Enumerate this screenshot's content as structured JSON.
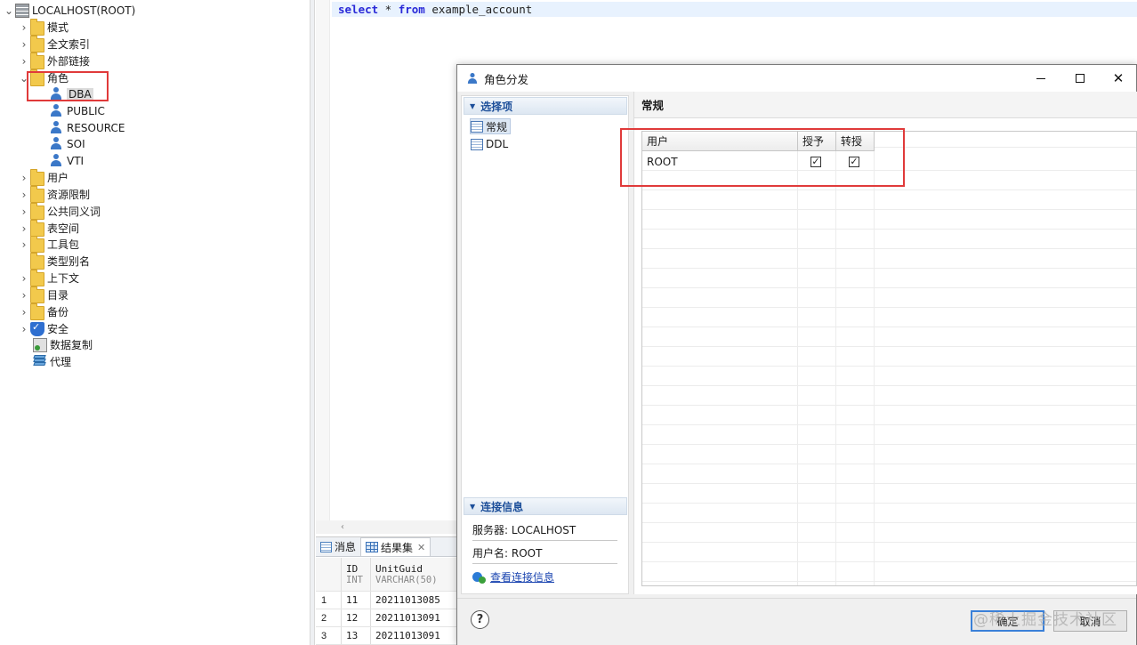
{
  "tree": {
    "root_label": "LOCALHOST(ROOT)",
    "items": [
      {
        "label": "模式"
      },
      {
        "label": "全文索引"
      },
      {
        "label": "外部链接"
      },
      {
        "label": "角色"
      },
      {
        "label": "DBA"
      },
      {
        "label": "PUBLIC"
      },
      {
        "label": "RESOURCE"
      },
      {
        "label": "SOI"
      },
      {
        "label": "VTI"
      },
      {
        "label": "用户"
      },
      {
        "label": "资源限制"
      },
      {
        "label": "公共同义词"
      },
      {
        "label": "表空间"
      },
      {
        "label": "工具包"
      },
      {
        "label": "类型别名"
      },
      {
        "label": "上下文"
      },
      {
        "label": "目录"
      },
      {
        "label": "备份"
      },
      {
        "label": "安全"
      },
      {
        "label": "数据复制"
      },
      {
        "label": "代理"
      }
    ]
  },
  "editor": {
    "kw_select": "select",
    "star": " * ",
    "kw_from": "from",
    "table": " example_account"
  },
  "results": {
    "tab_messages": "消息",
    "tab_resultset": "结果集",
    "columns": [
      {
        "name": "ID",
        "type": "INT"
      },
      {
        "name": "UnitGuid",
        "type": "VARCHAR(50)"
      }
    ],
    "rows": [
      {
        "num": "1",
        "id": "11",
        "guid": "20211013085"
      },
      {
        "num": "2",
        "id": "12",
        "guid": "20211013091"
      },
      {
        "num": "3",
        "id": "13",
        "guid": "20211013091"
      }
    ]
  },
  "dialog": {
    "title": "角色分发",
    "section_options": "选择项",
    "nav": [
      {
        "label": "常规"
      },
      {
        "label": "DDL"
      }
    ],
    "section_connection": "连接信息",
    "server_line": "服务器: LOCALHOST",
    "user_line": "用户名: ROOT",
    "view_connection_link": "查看连接信息",
    "right_title": "常规",
    "table": {
      "headers": {
        "user": "用户",
        "grant": "授予",
        "transfer": "转授"
      },
      "rows": [
        {
          "user": "ROOT",
          "grant": true,
          "transfer": true
        }
      ]
    },
    "ok_label": "确定",
    "cancel_label": "取消",
    "help_label": "?"
  },
  "watermark": "@稀土掘金技术社区",
  "colors": {
    "highlight_box": "#e03a3a",
    "keyword": "#2a2ad8",
    "link": "#1a44b0",
    "section_head_text": "#1d4f9a",
    "folder": "#f2c94c"
  }
}
